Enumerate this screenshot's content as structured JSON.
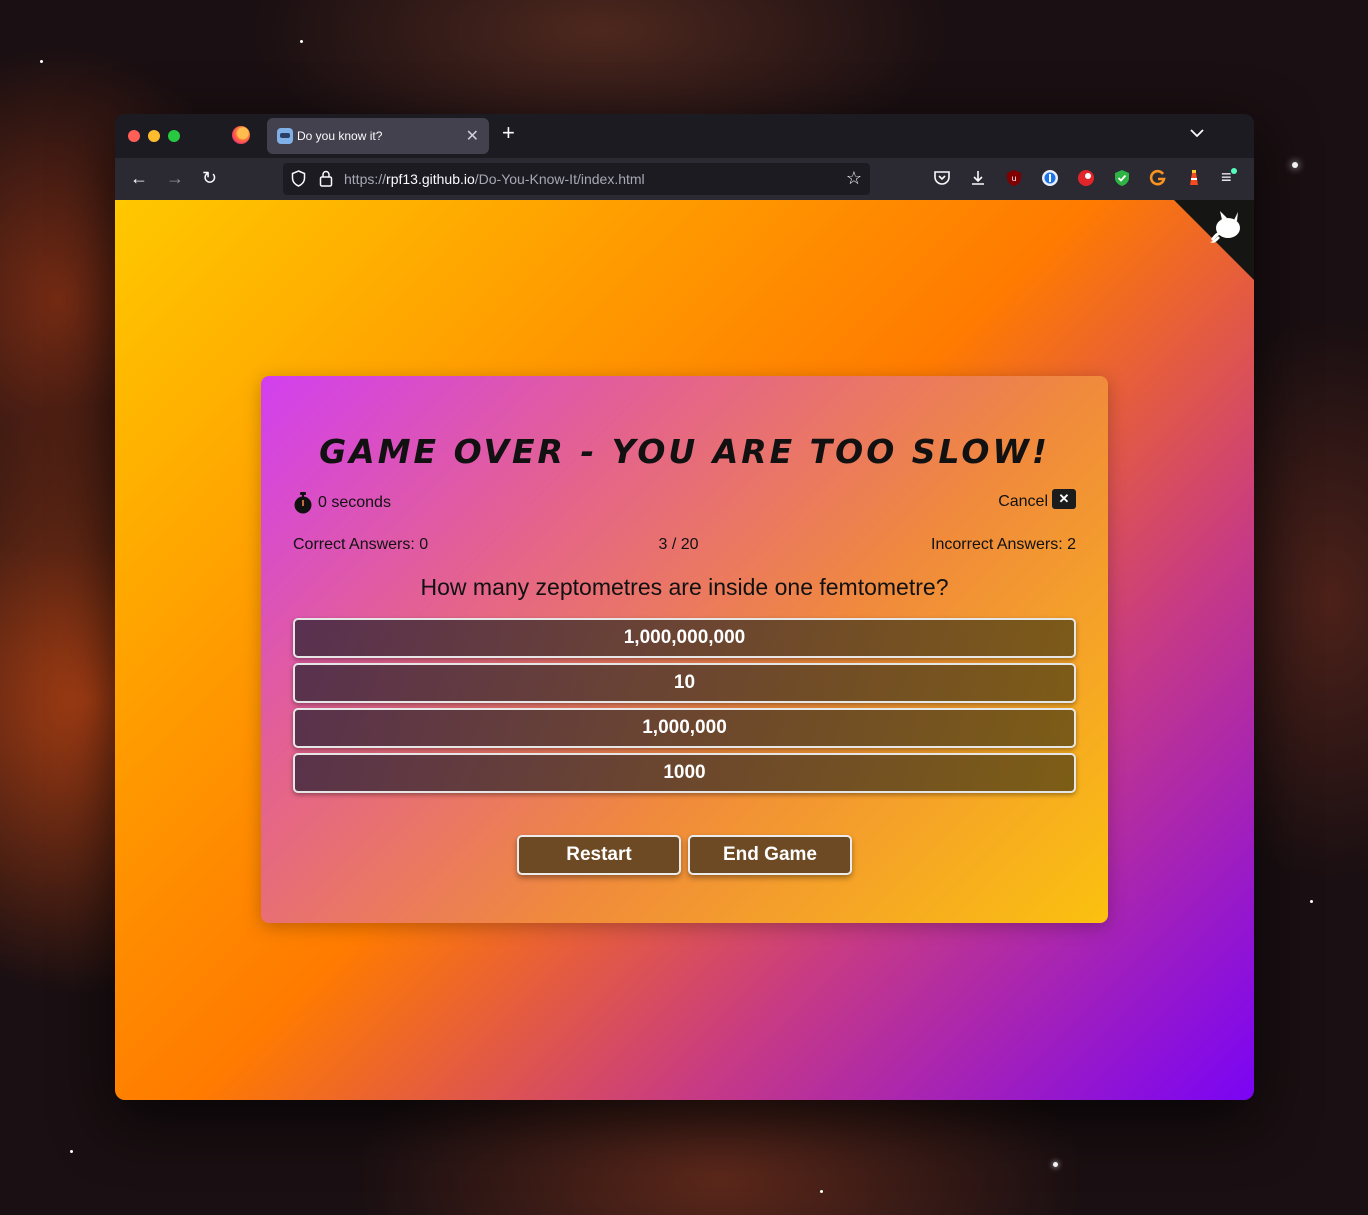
{
  "browser": {
    "tab_title": "Do you know it?",
    "tab_close": "✕",
    "new_tab": "+",
    "tab_list": "⌄",
    "url_prefix": "https://",
    "url_host": "rpf13.github.io",
    "url_path": "/Do-You-Know-It/index.html",
    "nav_back": "←",
    "nav_forward": "→",
    "nav_reload": "↻",
    "bookmark_star": "☆",
    "menu": "≡"
  },
  "game": {
    "title": "Game Over - You are too slow!",
    "timer_text": "0 seconds",
    "cancel_label": "Cancel",
    "cancel_x": "✕",
    "correct_answers": "Correct Answers: 0",
    "progress": "3 / 20",
    "incorrect_answers": "Incorrect Answers: 2",
    "question": "How many zeptometres are inside one femtometre?",
    "answers": [
      "1,000,000,000",
      "10",
      "1,000,000",
      "1000"
    ],
    "restart_label": "Restart",
    "end_game_label": "End Game"
  }
}
